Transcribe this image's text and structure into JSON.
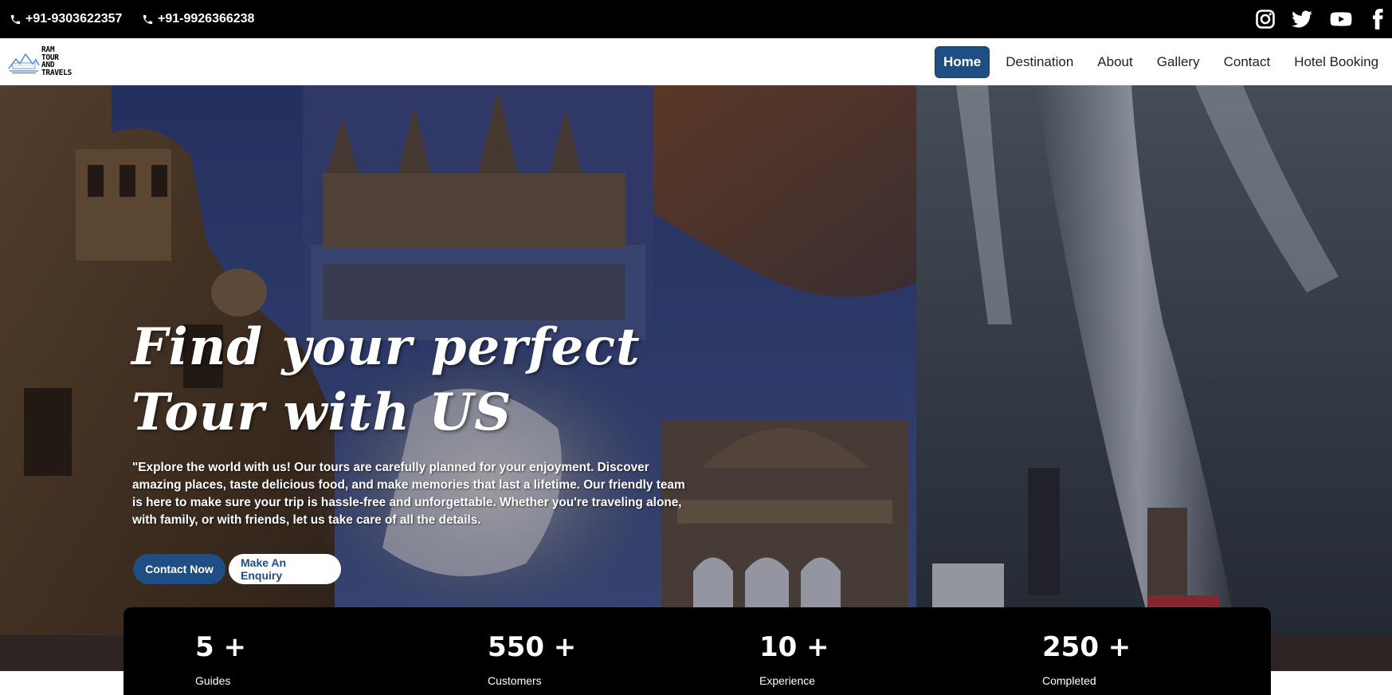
{
  "topbar": {
    "phones": [
      "+91-9303622357",
      "+91-9926366238"
    ],
    "social_icons": [
      "instagram-icon",
      "twitter-icon",
      "youtube-icon",
      "facebook-icon"
    ]
  },
  "brand": {
    "logo_lines": [
      "RAM",
      "TOUR",
      "AND",
      "TRAVELS"
    ]
  },
  "nav": {
    "items": [
      "Home",
      "Destination",
      "About",
      "Gallery",
      "Contact",
      "Hotel Booking"
    ],
    "active": "Home"
  },
  "hero": {
    "headline_lines": [
      "Find your perfect",
      "Tour with US"
    ],
    "description": "\"Explore the world with us! Our tours are carefully planned for your enjoyment. Discover amazing places, taste delicious food, and make memories that last a lifetime. Our friendly team is here to make sure your trip is hassle-free and unforgettable. Whether you're traveling alone, with family, or with friends, let us take care of all the details.",
    "buttons": {
      "contact": "Contact Now",
      "enquiry": "Make An Enquiry"
    }
  },
  "stats": [
    {
      "value": "5 +",
      "label": "Guides"
    },
    {
      "value": "550 +",
      "label": "Customers"
    },
    {
      "value": "10 +",
      "label": "Experience"
    },
    {
      "value": "250 +",
      "label": "Completed"
    }
  ],
  "colors": {
    "primary": "#1f4e84",
    "topbar": "#000000",
    "stats_bg": "#000000"
  }
}
